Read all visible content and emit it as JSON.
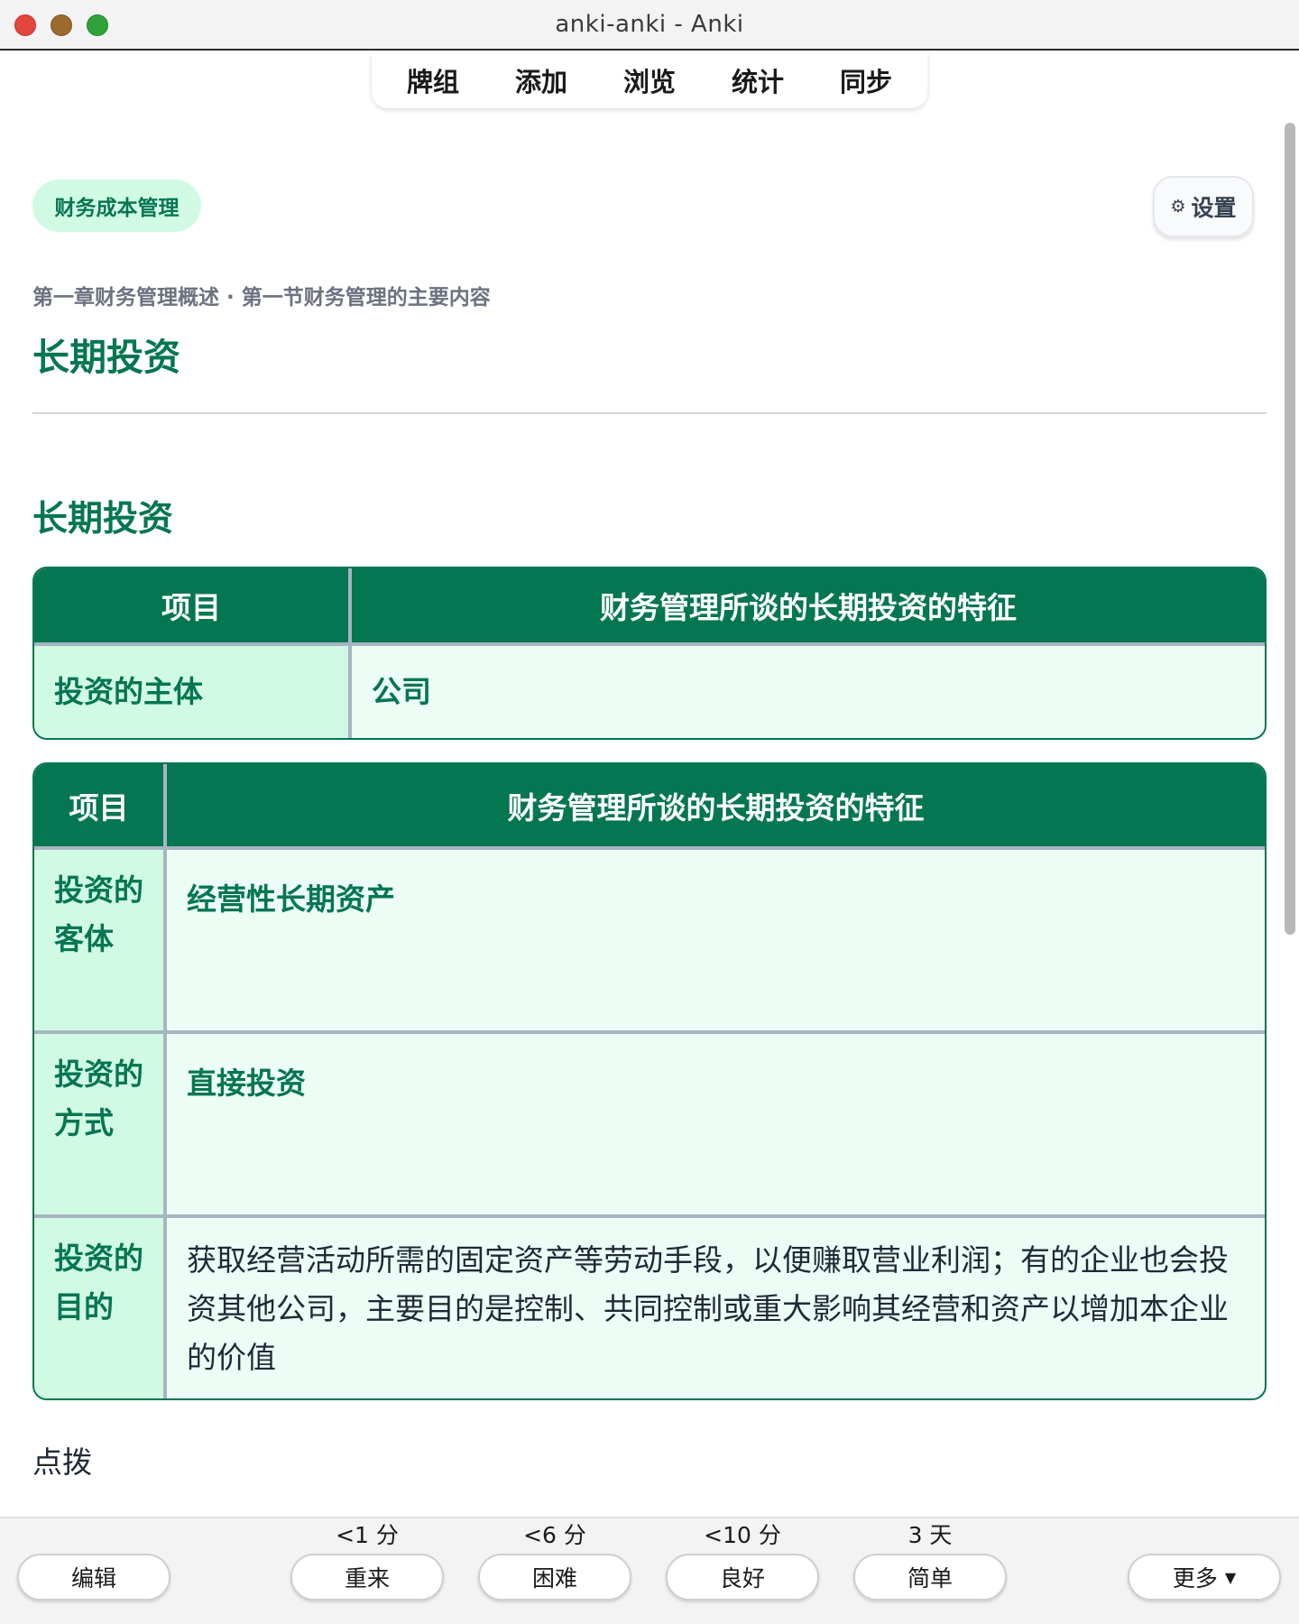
{
  "window": {
    "title": "anki-anki - Anki"
  },
  "tabs": [
    {
      "label": "牌组"
    },
    {
      "label": "添加"
    },
    {
      "label": "浏览"
    },
    {
      "label": "统计"
    },
    {
      "label": "同步"
    }
  ],
  "deck": {
    "tag": "财务成本管理"
  },
  "settings": {
    "icon": "⚙",
    "label": "设置"
  },
  "card": {
    "breadcrumb": "第一章财务管理概述 · 第一节财务管理的主要内容",
    "title": "长期投资",
    "section_title": "长期投资",
    "table1": {
      "headers": [
        "项目",
        "财务管理所谈的长期投资的特征"
      ],
      "rows": [
        {
          "key": "投资的主体",
          "value": "公司"
        }
      ]
    },
    "table2": {
      "headers": [
        "项目",
        "财务管理所谈的长期投资的特征"
      ],
      "rows": [
        {
          "key": "投资的客体",
          "value": "经营性长期资产"
        },
        {
          "key": "投资的方式",
          "value": "直接投资"
        },
        {
          "key": "投资的目的",
          "value": "获取经营活动所需的固定资产等劳动手段，以便赚取营业利润；有的企业也会投资其他公司，主要目的是控制、共同控制或重大影响其经营和资产以增加本企业的价值"
        }
      ]
    },
    "tip_label": "点拨"
  },
  "review_bar": {
    "edit": "编辑",
    "more": "更多",
    "more_icon": "chevron-down",
    "answers": [
      {
        "interval": "<1 分",
        "label": "重来"
      },
      {
        "interval": "<6 分",
        "label": "困难"
      },
      {
        "interval": "<10 分",
        "label": "良好"
      },
      {
        "interval": "3 天",
        "label": "简单"
      }
    ]
  },
  "colors": {
    "accent": "#057652",
    "key_bg": "#d1fae5",
    "table_bg": "#ecfdf5",
    "close": "#e3443b",
    "minimize": "#9b6b2d",
    "maximize": "#2fa33a"
  }
}
